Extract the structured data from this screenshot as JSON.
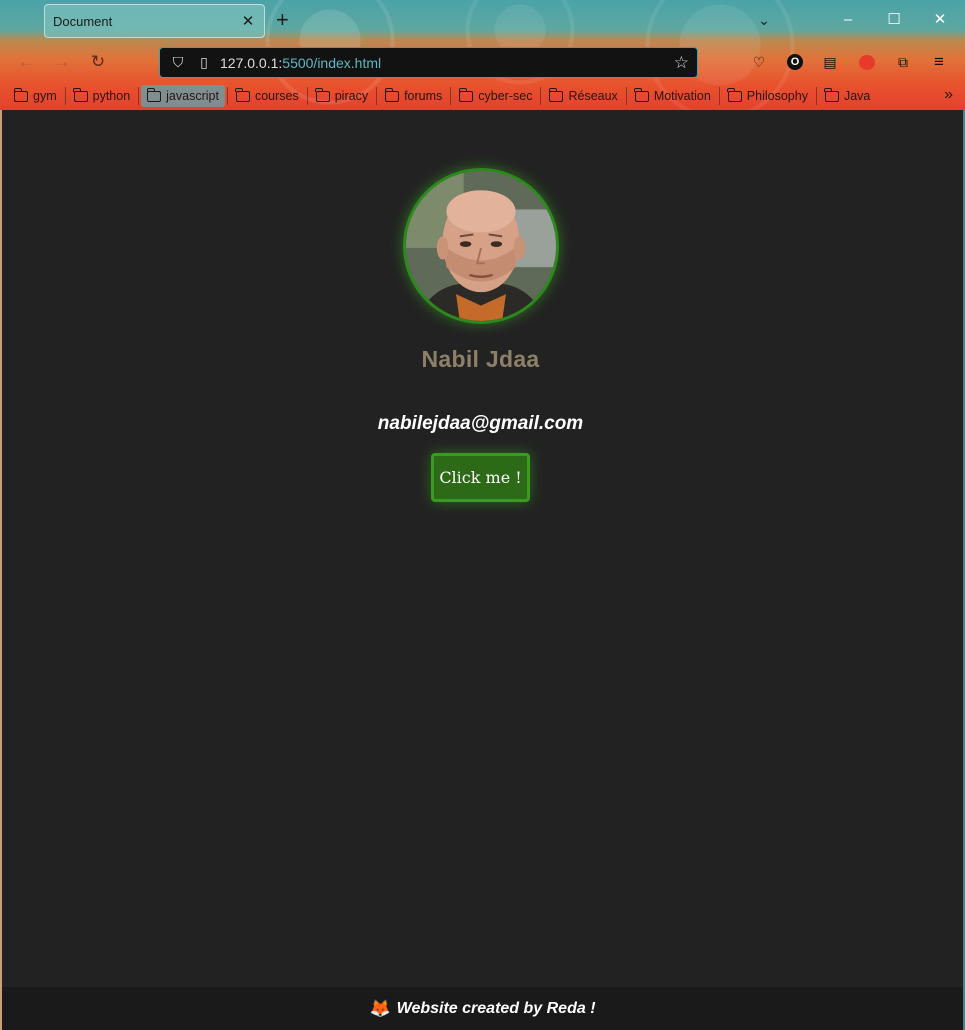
{
  "browser": {
    "tab_title": "Document",
    "tab_close": "✕",
    "new_tab": "+",
    "url_host": "127.0.0.1:",
    "url_rest": "5500/index.html",
    "bookmarks": [
      "gym",
      "python",
      "javascript",
      "courses",
      "piracy",
      "forums",
      "cyber-sec",
      "Réseaux",
      "Motivation",
      "Philosophy",
      "Java"
    ],
    "active_bookmark": "javascript",
    "more_bookmarks": "»"
  },
  "profile": {
    "name": "Nabil Jdaa",
    "email": "nabilejdaa@gmail.com",
    "button_label": "Click me !"
  },
  "footer": {
    "text": "Website created by Reda !",
    "icon": "fox-icon"
  },
  "colors": {
    "page_background": "#222222",
    "name_color": "#8d8068",
    "button_bg": "#2d6a17",
    "button_border": "#3b9a22",
    "avatar_border": "#2c8a1c"
  }
}
